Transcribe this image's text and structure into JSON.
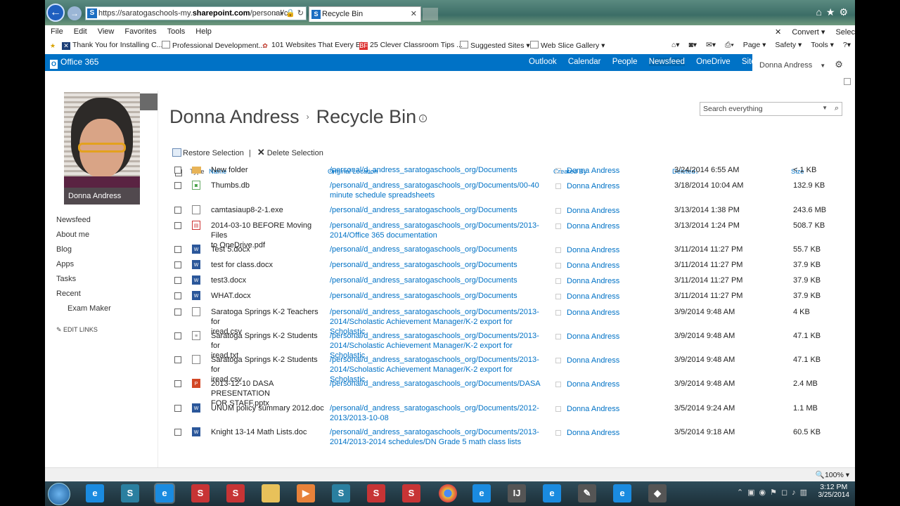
{
  "browser": {
    "url_prefix": "https://saratogaschools-my.",
    "url_bold": "sharepoint.com",
    "url_suffix": "/personal/c",
    "url_icons": "⌕ ▾ 🔒 ↻",
    "tab_title": "Recycle Bin",
    "tab_close": "✕",
    "menu": [
      "File",
      "Edit",
      "View",
      "Favorites",
      "Tools",
      "Help"
    ],
    "menu_right": [
      "Convert ▾",
      "Selec"
    ],
    "favorites": [
      "Thank You for Installing C...",
      "Professional Development...",
      "101 Websites That Every El...",
      "25 Clever Classroom Tips ...",
      "Suggested Sites ▾",
      "Web Slice Gallery ▾"
    ],
    "command_bar": [
      "Page ▾",
      "Safety ▾",
      "Tools ▾"
    ],
    "zoom": "100%"
  },
  "suite": {
    "logo": "Office 365",
    "links": [
      "Outlook",
      "Calendar",
      "People",
      "Newsfeed",
      "OneDrive",
      "Sites",
      "•••"
    ],
    "user": "Donna Andress"
  },
  "profile": {
    "name": "Donna Andress",
    "nav": [
      "Newsfeed",
      "About me",
      "Blog",
      "Apps",
      "Tasks",
      "Recent"
    ],
    "recent_item": "Exam Maker",
    "edit_links": "EDIT LINKS"
  },
  "page": {
    "site": "Donna Andress",
    "separator": "›",
    "title": "Recycle Bin",
    "search_placeholder": "Search everything",
    "restore": "Restore Selection",
    "delete": "Delete Selection",
    "pipe": "|"
  },
  "columns": {
    "type": "Type",
    "name": "Name",
    "location": "Original Location",
    "created_by": "Created By",
    "deleted": "Deleted↓",
    "size": "Size"
  },
  "rows": [
    {
      "icon": "folder",
      "name1": "New folder",
      "name2": "",
      "loc1": "/personal/d_andress_saratogaschools_org/Documents",
      "loc2": "",
      "by": "Donna Andress",
      "deleted": "3/24/2014 6:55 AM",
      "size": "< 1 KB"
    },
    {
      "icon": "db",
      "name1": "Thumbs.db",
      "name2": "",
      "loc1": "/personal/d_andress_saratogaschools_org/Documents/00-40",
      "loc2": "minute schedule spreadsheets",
      "by": "Donna Andress",
      "deleted": "3/18/2014 10:04 AM",
      "size": "132.9 KB"
    },
    {
      "icon": "file",
      "name1": "camtasiaup8-2-1.exe",
      "name2": "",
      "loc1": "/personal/d_andress_saratogaschools_org/Documents",
      "loc2": "",
      "by": "Donna Andress",
      "deleted": "3/13/2014 1:38 PM",
      "size": "243.6 MB"
    },
    {
      "icon": "pdf",
      "name1": "2014-03-10 BEFORE Moving Files",
      "name2": "to OneDrive.pdf",
      "loc1": "/personal/d_andress_saratogaschools_org/Documents/2013-",
      "loc2": "2014/Office 365 documentation",
      "by": "Donna Andress",
      "deleted": "3/13/2014 1:24 PM",
      "size": "508.7 KB"
    },
    {
      "icon": "word",
      "name1": "Test 5.docx",
      "name2": "",
      "loc1": "/personal/d_andress_saratogaschools_org/Documents",
      "loc2": "",
      "by": "Donna Andress",
      "deleted": "3/11/2014 11:27 PM",
      "size": "55.7 KB"
    },
    {
      "icon": "word",
      "name1": "test for class.docx",
      "name2": "",
      "loc1": "/personal/d_andress_saratogaschools_org/Documents",
      "loc2": "",
      "by": "Donna Andress",
      "deleted": "3/11/2014 11:27 PM",
      "size": "37.9 KB"
    },
    {
      "icon": "word",
      "name1": "test3.docx",
      "name2": "",
      "loc1": "/personal/d_andress_saratogaschools_org/Documents",
      "loc2": "",
      "by": "Donna Andress",
      "deleted": "3/11/2014 11:27 PM",
      "size": "37.9 KB"
    },
    {
      "icon": "word",
      "name1": "WHAT.docx",
      "name2": "",
      "loc1": "/personal/d_andress_saratogaschools_org/Documents",
      "loc2": "",
      "by": "Donna Andress",
      "deleted": "3/11/2014 11:27 PM",
      "size": "37.9 KB"
    },
    {
      "icon": "file",
      "name1": "Saratoga Springs K-2 Teachers for",
      "name2": "iread.csv",
      "loc1": "/personal/d_andress_saratogaschools_org/Documents/2013-",
      "loc2": "2014/Scholastic Achievement Manager/K-2 export for Scholastic",
      "by": "Donna Andress",
      "deleted": "3/9/2014 9:48 AM",
      "size": "4 KB"
    },
    {
      "icon": "txt",
      "name1": "Saratoga Springs K-2 Students for",
      "name2": "iread.txt",
      "loc1": "/personal/d_andress_saratogaschools_org/Documents/2013-",
      "loc2": "2014/Scholastic Achievement Manager/K-2 export for Scholastic",
      "by": "Donna Andress",
      "deleted": "3/9/2014 9:48 AM",
      "size": "47.1 KB"
    },
    {
      "icon": "file",
      "name1": "Saratoga Springs K-2 Students for",
      "name2": "iread.csv",
      "loc1": "/personal/d_andress_saratogaschools_org/Documents/2013-",
      "loc2": "2014/Scholastic Achievement Manager/K-2 export for Scholastic",
      "by": "Donna Andress",
      "deleted": "3/9/2014 9:48 AM",
      "size": "47.1 KB"
    },
    {
      "icon": "ppt",
      "name1": "2013-12-10 DASA PRESENTATION",
      "name2": "FOR STAFF.pptx",
      "loc1": "/personal/d_andress_saratogaschools_org/Documents/DASA",
      "loc2": "",
      "by": "Donna Andress",
      "deleted": "3/9/2014 9:48 AM",
      "size": "2.4 MB"
    },
    {
      "icon": "word",
      "name1": "UNUM policy summary 2012.doc",
      "name2": "",
      "loc1": "/personal/d_andress_saratogaschools_org/Documents/2012-",
      "loc2": "2013/2013-10-08",
      "by": "Donna Andress",
      "deleted": "3/5/2014 9:24 AM",
      "size": "1.1 MB"
    },
    {
      "icon": "word",
      "name1": "Knight 13-14 Math Lists.doc",
      "name2": "",
      "loc1": "/personal/d_andress_saratogaschools_org/Documents/2013-",
      "loc2": "2014/2013-2014 schedules/DN Grade 5 math class lists",
      "by": "Donna Andress",
      "deleted": "3/5/2014 9:18 AM",
      "size": "60.5 KB"
    }
  ],
  "taskbar": {
    "time": "3:12 PM",
    "date": "3/25/2014"
  }
}
